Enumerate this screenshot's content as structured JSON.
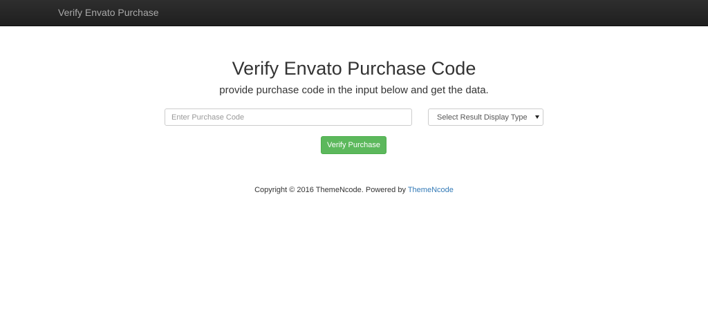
{
  "navbar": {
    "brand": "Verify Envato Purchase"
  },
  "main": {
    "title": "Verify Envato Purchase Code",
    "subtitle": "provide purchase code in the input below and get the data.",
    "code_input": {
      "placeholder": "Enter Purchase Code",
      "value": ""
    },
    "display_select": {
      "selected": "Select Result Display Type"
    },
    "verify_button": "Verify Purchase"
  },
  "footer": {
    "copyright_text": "Copyright © 2016 ThemeNcode. Powered by ",
    "link_text": "ThemeNcode"
  },
  "colors": {
    "navbar_bg": "#222222",
    "brand_text": "#a9a9a9",
    "button_green": "#5cb85c",
    "link_blue": "#337ab7"
  }
}
